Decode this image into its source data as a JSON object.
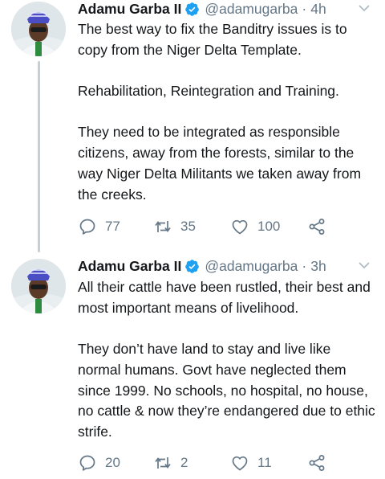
{
  "colors": {
    "accent": "#1da1f2",
    "muted": "#657786",
    "text": "#14171a",
    "thread_line": "#c4cfd6"
  },
  "tweets": [
    {
      "name": "Adamu Garba II",
      "handle": "@adamugarba",
      "separator": "·",
      "time": "4h",
      "paragraphs": [
        "The best way to fix the Banditry issues is to copy from the Niger Delta Template.",
        "Rehabilitation, Reintegration and Training.",
        "They need to be integrated as responsible citizens, away from the forests, similar to the way Niger Delta Militants we taken away from the creeks."
      ],
      "replies": "77",
      "retweets": "35",
      "likes": "100"
    },
    {
      "name": "Adamu Garba II",
      "handle": "@adamugarba",
      "separator": "·",
      "time": "3h",
      "paragraphs": [
        "All their cattle have been rustled, their best and most important means of livelihood.",
        "They don’t have land to stay and live like normal humans. Govt have neglected them since 1999. No schools, no hospital, no house, no cattle & now they’re endangered due to ethic strife."
      ],
      "replies": "20",
      "retweets": "2",
      "likes": "11"
    }
  ],
  "icons": [
    "verified-badge-icon",
    "chevron-down-icon",
    "reply-icon",
    "retweet-icon",
    "like-icon",
    "share-icon"
  ]
}
